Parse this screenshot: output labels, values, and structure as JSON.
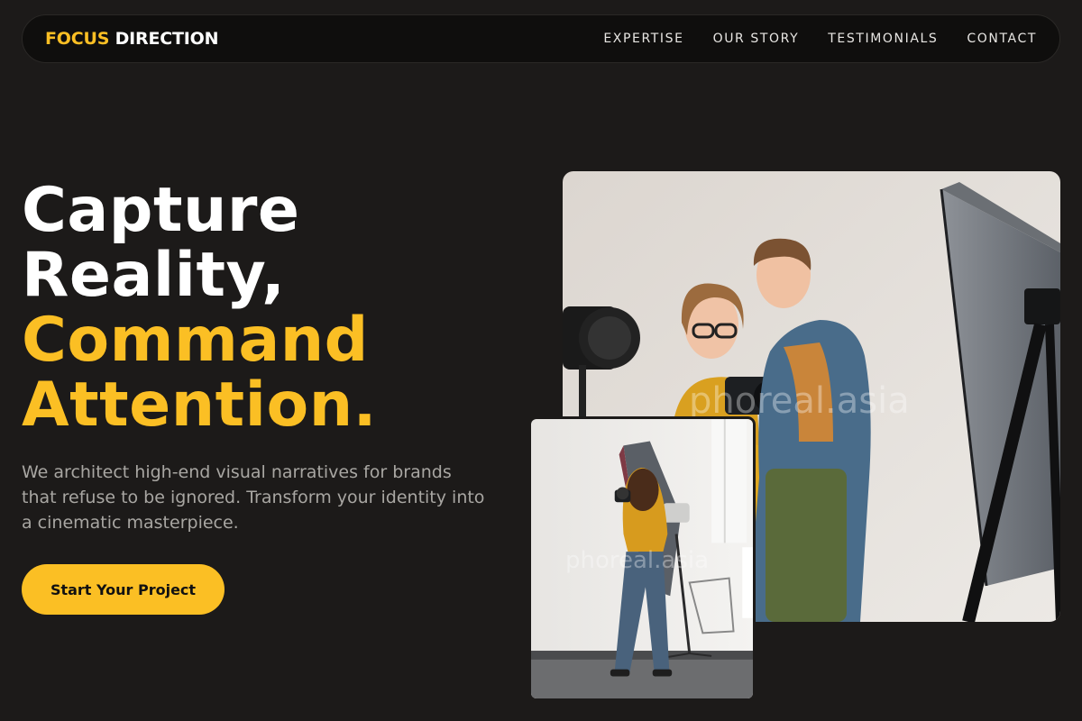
{
  "nav": {
    "logo_accent": "FOCUS",
    "logo_rest": "DIRECTION",
    "links": [
      {
        "label": "EXPERTISE"
      },
      {
        "label": "OUR STORY"
      },
      {
        "label": "TESTIMONIALS"
      },
      {
        "label": "CONTACT"
      }
    ]
  },
  "hero": {
    "line1": "Capture",
    "line2": "Reality,",
    "line3": "Command",
    "line4": "Attention.",
    "subtext": "We architect high-end visual narratives for brands that refuse to be ignored. Transform your identity into a cinematic masterpiece.",
    "cta_label": "Start Your Project"
  },
  "images": {
    "main_watermark": "phoreal.asia",
    "small_watermark": "phoreal.asia"
  },
  "colors": {
    "background": "#1c1a19",
    "accent": "#fbbf24",
    "nav_bg": "#0f0e0d"
  }
}
